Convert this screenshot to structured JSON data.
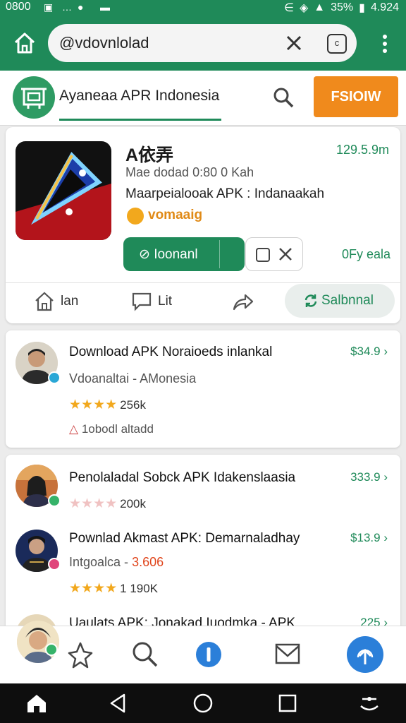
{
  "status_bar": {
    "time": "0800",
    "battery": "35%",
    "clock_right": "4.924"
  },
  "browser": {
    "url": "@vdovnlolad",
    "tab_count_icon": "c"
  },
  "header": {
    "title": "Ayaneaa APR Indonesia",
    "button_label": "FSIOIW"
  },
  "featured": {
    "name": "A依弄",
    "size": "129.5.9m",
    "meta": "Mae dodad 0:80 0 Kah",
    "description": "Maarpeialooak APK : Indanaakah",
    "developer": "vomaaig",
    "download_label": "Ioonanl",
    "version": "0Fy eala",
    "actions": {
      "home_label": "lan",
      "comment_label": "Lit",
      "subscribe_label": "Salbnnal"
    },
    "colors": {
      "accent": "#1f8a59",
      "orange": "#f08a1c"
    }
  },
  "items": [
    {
      "title": "Download APK Noraioeds inlankal",
      "subtitle": "Vdoanaltai - AMonesia",
      "price": "$34.9",
      "rating_count": "256k",
      "link": "1obodl altadd"
    },
    {
      "title": "Penolaladal Sobck APK Idakenslaasia",
      "price": "333.9",
      "rating_count": "200k"
    },
    {
      "title": "Pownlad Akmast APK: Demarnaladhay",
      "subtitle_prefix": "Intgoalca - ",
      "subtitle_accent": "3.606",
      "price": "$13.9",
      "rating_count": "1 190K"
    },
    {
      "title": "Uaulats APK: Jonakad Iuodmka - APK",
      "price": "225"
    }
  ],
  "icons": {
    "nav": [
      "star-icon",
      "search-icon",
      "info-icon",
      "mail-icon",
      "upload-icon"
    ],
    "system": [
      "home-icon",
      "back-icon",
      "circle-home-icon",
      "recents-icon",
      "assistant-icon"
    ]
  }
}
